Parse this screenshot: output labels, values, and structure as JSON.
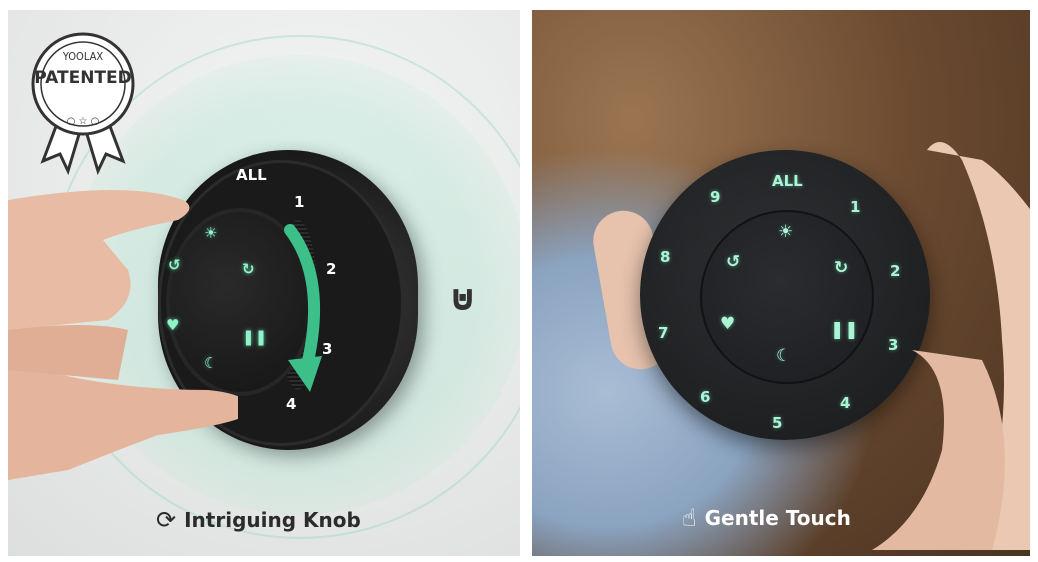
{
  "left": {
    "badge_brand": "YOOLAX",
    "badge_text": "PATENTED",
    "knob_labels": [
      "ALL",
      "1",
      "2",
      "3",
      "4"
    ],
    "caption": "Intriguing Knob",
    "caption_icon": "rotate-icon"
  },
  "right": {
    "remote_labels": [
      "ALL",
      "1",
      "2",
      "3",
      "4",
      "5",
      "6",
      "7",
      "8",
      "9"
    ],
    "caption": "Gentle Touch",
    "caption_icon": "touch-hand-icon"
  },
  "colors": {
    "glow": "#8ff2c9",
    "halo": "#a8e0c8"
  }
}
